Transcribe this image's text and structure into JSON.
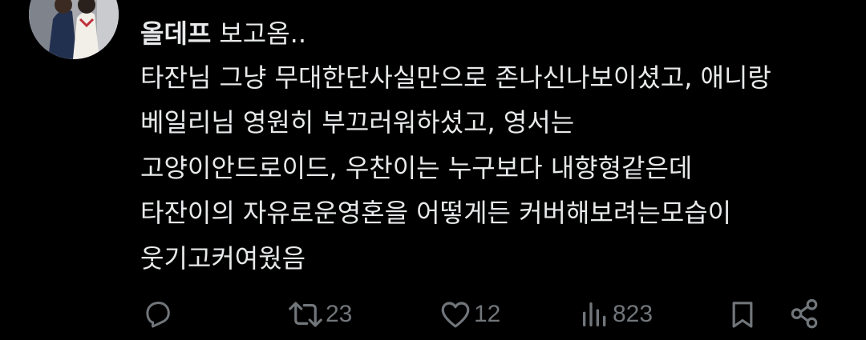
{
  "post": {
    "author": "올데프",
    "first_text": "보고옴..",
    "lines": [
      "타잔님 그냥 무대한단사실만으로 존나신나보이셨고, 애니랑",
      "베일리님 영원히 부끄러워하셨고, 영서는",
      "고양이안드로이드, 우찬이는 누구보다 내향형같은데",
      "타잔이의 자유로운영혼을 어떻게든 커버해보려는모습이",
      "웃기고커여웠음"
    ]
  },
  "actions": {
    "reply": {
      "icon": "reply-icon"
    },
    "repost": {
      "icon": "repost-icon",
      "count": "23"
    },
    "like": {
      "icon": "heart-icon",
      "count": "12"
    },
    "views": {
      "icon": "views-icon",
      "count": "823"
    },
    "bookmark": {
      "icon": "bookmark-icon"
    },
    "share": {
      "icon": "share-icon"
    }
  },
  "colors": {
    "background": "#000000",
    "text": "#e7e9ea",
    "icon": "#71767b"
  }
}
